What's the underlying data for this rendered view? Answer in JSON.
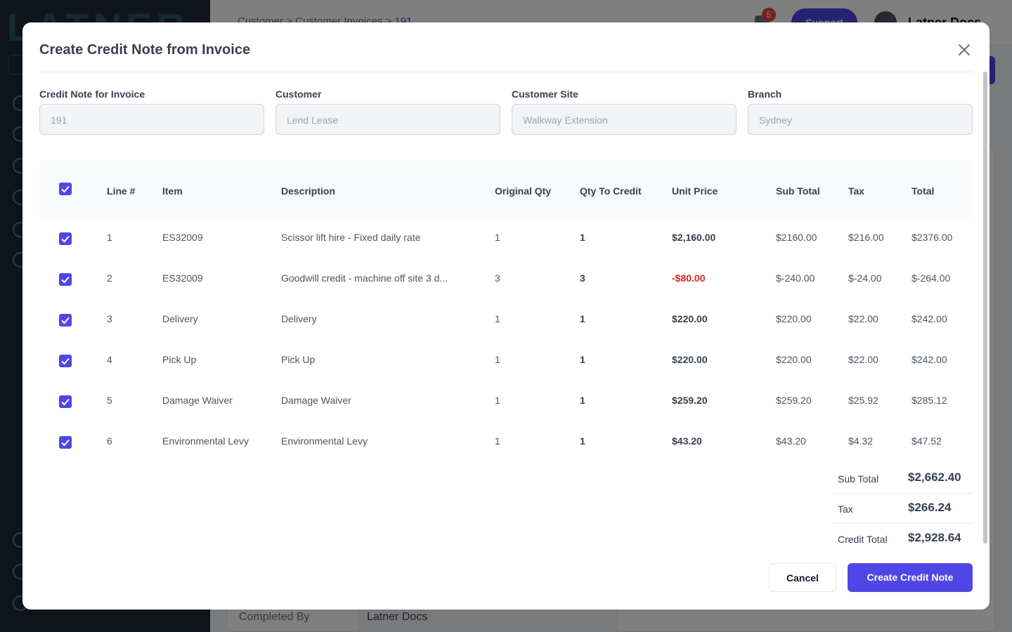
{
  "background": {
    "logo_text": "LATNER",
    "breadcrumb": [
      "Customer",
      "Customer Invoices",
      "191"
    ],
    "notification_count": "5",
    "support_label": "Support",
    "user_name": "Latner Docs",
    "completed_by_label": "Completed By",
    "completed_by_value": "Latner Docs"
  },
  "modal": {
    "title": "Create Credit Note from Invoice",
    "fields": [
      {
        "label": "Credit Note for Invoice",
        "value": "191"
      },
      {
        "label": "Customer",
        "value": "Lend Lease"
      },
      {
        "label": "Customer Site",
        "value": "Walkway Extension"
      },
      {
        "label": "Branch",
        "value": "Sydney"
      }
    ],
    "table": {
      "headers": {
        "line": "Line #",
        "item": "Item",
        "description": "Description",
        "original_qty": "Original Qty",
        "qty_to_credit": "Qty To Credit",
        "unit_price": "Unit Price",
        "sub_total": "Sub Total",
        "tax": "Tax",
        "total": "Total"
      },
      "rows": [
        {
          "line": "1",
          "item": "ES32009",
          "description": "Scissor lift hire - Fixed daily rate",
          "original_qty": "1",
          "qty_to_credit": "1",
          "unit_price": "$2,160.00",
          "sub_total": "$2160.00",
          "tax": "$216.00",
          "total": "$2376.00",
          "checked": true
        },
        {
          "line": "2",
          "item": "ES32009",
          "description": "Goodwill credit - machine off site 3 d...",
          "original_qty": "3",
          "qty_to_credit": "3",
          "unit_price": "-$80.00",
          "sub_total": "$-240.00",
          "tax": "$-24.00",
          "total": "$-264.00",
          "checked": true
        },
        {
          "line": "3",
          "item": "Delivery",
          "description": "Delivery",
          "original_qty": "1",
          "qty_to_credit": "1",
          "unit_price": "$220.00",
          "sub_total": "$220.00",
          "tax": "$22.00",
          "total": "$242.00",
          "checked": true
        },
        {
          "line": "4",
          "item": "Pick Up",
          "description": "Pick Up",
          "original_qty": "1",
          "qty_to_credit": "1",
          "unit_price": "$220.00",
          "sub_total": "$220.00",
          "tax": "$22.00",
          "total": "$242.00",
          "checked": true
        },
        {
          "line": "5",
          "item": "Damage Waiver",
          "description": "Damage Waiver",
          "original_qty": "1",
          "qty_to_credit": "1",
          "unit_price": "$259.20",
          "sub_total": "$259.20",
          "tax": "$25.92",
          "total": "$285.12",
          "checked": true
        },
        {
          "line": "6",
          "item": "Environmental Levy",
          "description": "Environmental Levy",
          "original_qty": "1",
          "qty_to_credit": "1",
          "unit_price": "$43.20",
          "sub_total": "$43.20",
          "tax": "$4.32",
          "total": "$47.52",
          "checked": true
        }
      ]
    },
    "totals": {
      "sub_total_label": "Sub Total",
      "sub_total": "$2,662.40",
      "tax_label": "Tax",
      "tax": "$266.24",
      "credit_total_label": "Credit Total",
      "credit_total": "$2,928.64"
    },
    "buttons": {
      "cancel": "Cancel",
      "create": "Create Credit Note"
    },
    "colors": {
      "accent": "#4f46e5",
      "negative": "#dc2626"
    }
  }
}
